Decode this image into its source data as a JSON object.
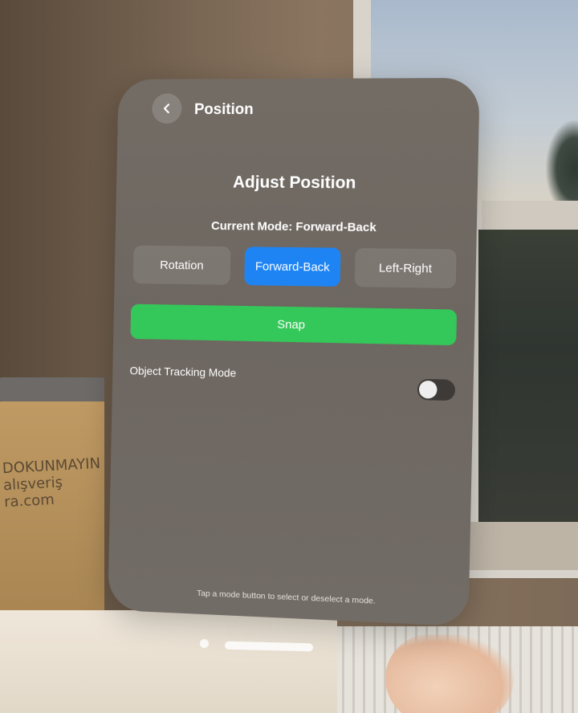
{
  "nav": {
    "title": "Position"
  },
  "main": {
    "heading": "Adjust Position",
    "current_mode_label": "Current Mode: Forward-Back",
    "modes": [
      {
        "label": "Rotation",
        "selected": false
      },
      {
        "label": "Forward-Back",
        "selected": true
      },
      {
        "label": "Left-Right",
        "selected": false
      }
    ],
    "snap_label": "Snap",
    "tracking_label": "Object Tracking Mode",
    "tracking_enabled": false,
    "footer_hint": "Tap a mode button to select or deselect a mode."
  },
  "environment": {
    "box_text": "DOKUNMAYIN\nalışveriş\nra.com"
  },
  "colors": {
    "accent_blue": "#1e84f4",
    "snap_green": "#34c759"
  },
  "icons": {
    "back": "chevron-left-icon"
  }
}
